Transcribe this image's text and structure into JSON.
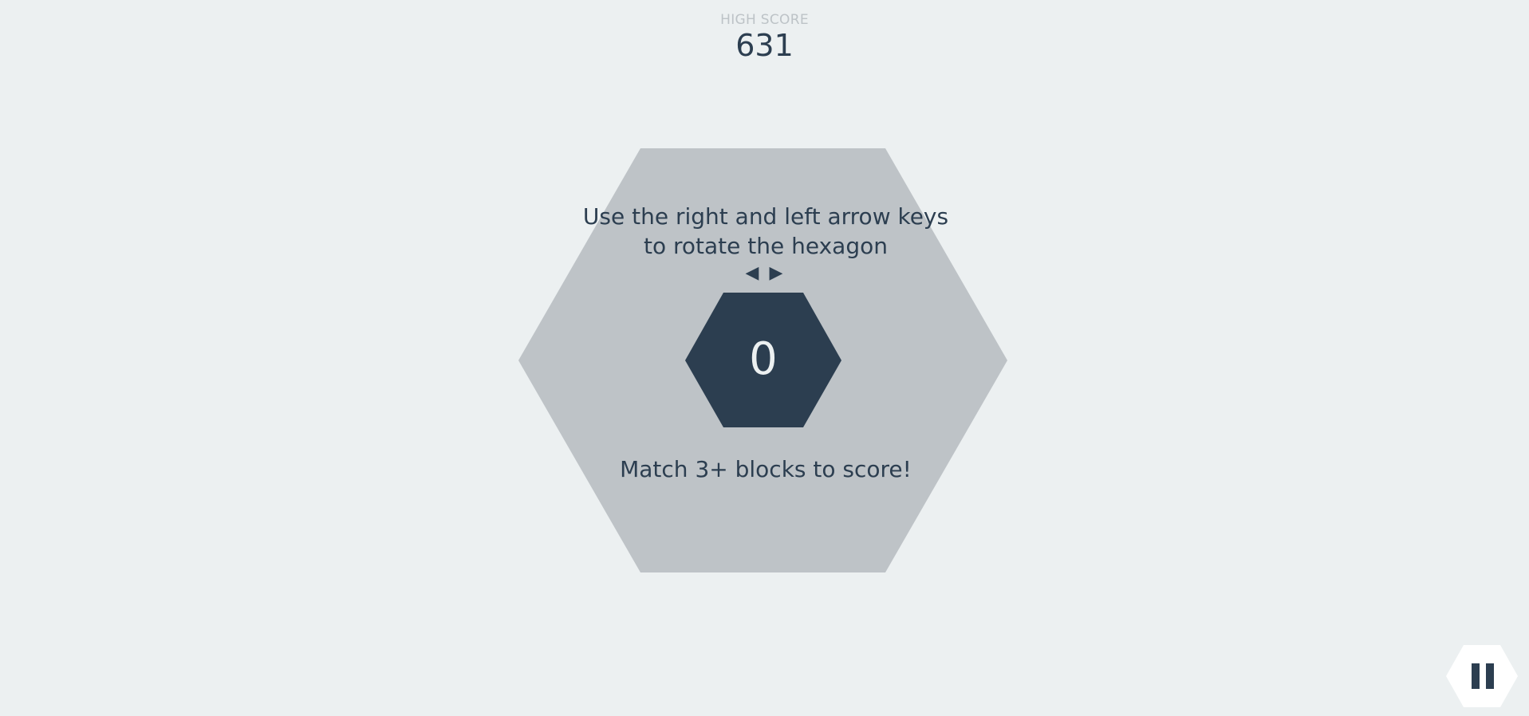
{
  "header": {
    "high_score_label": "HIGH SCORE",
    "high_score_value": "631"
  },
  "game": {
    "instructions": {
      "line1": "Use the right and left arrow keys",
      "line2": "to rotate the hexagon"
    },
    "arrow_left": "◀",
    "arrow_right": "▶",
    "score": "0",
    "hint": "Match 3+ blocks to score!"
  },
  "controls": {
    "pause_icon": "pause-icon"
  },
  "colors": {
    "background": "#ecf0f1",
    "board": "#bdc3c7",
    "center_hex": "#2c3e50",
    "text": "#2c3e50",
    "muted": "#bdc3c7"
  }
}
